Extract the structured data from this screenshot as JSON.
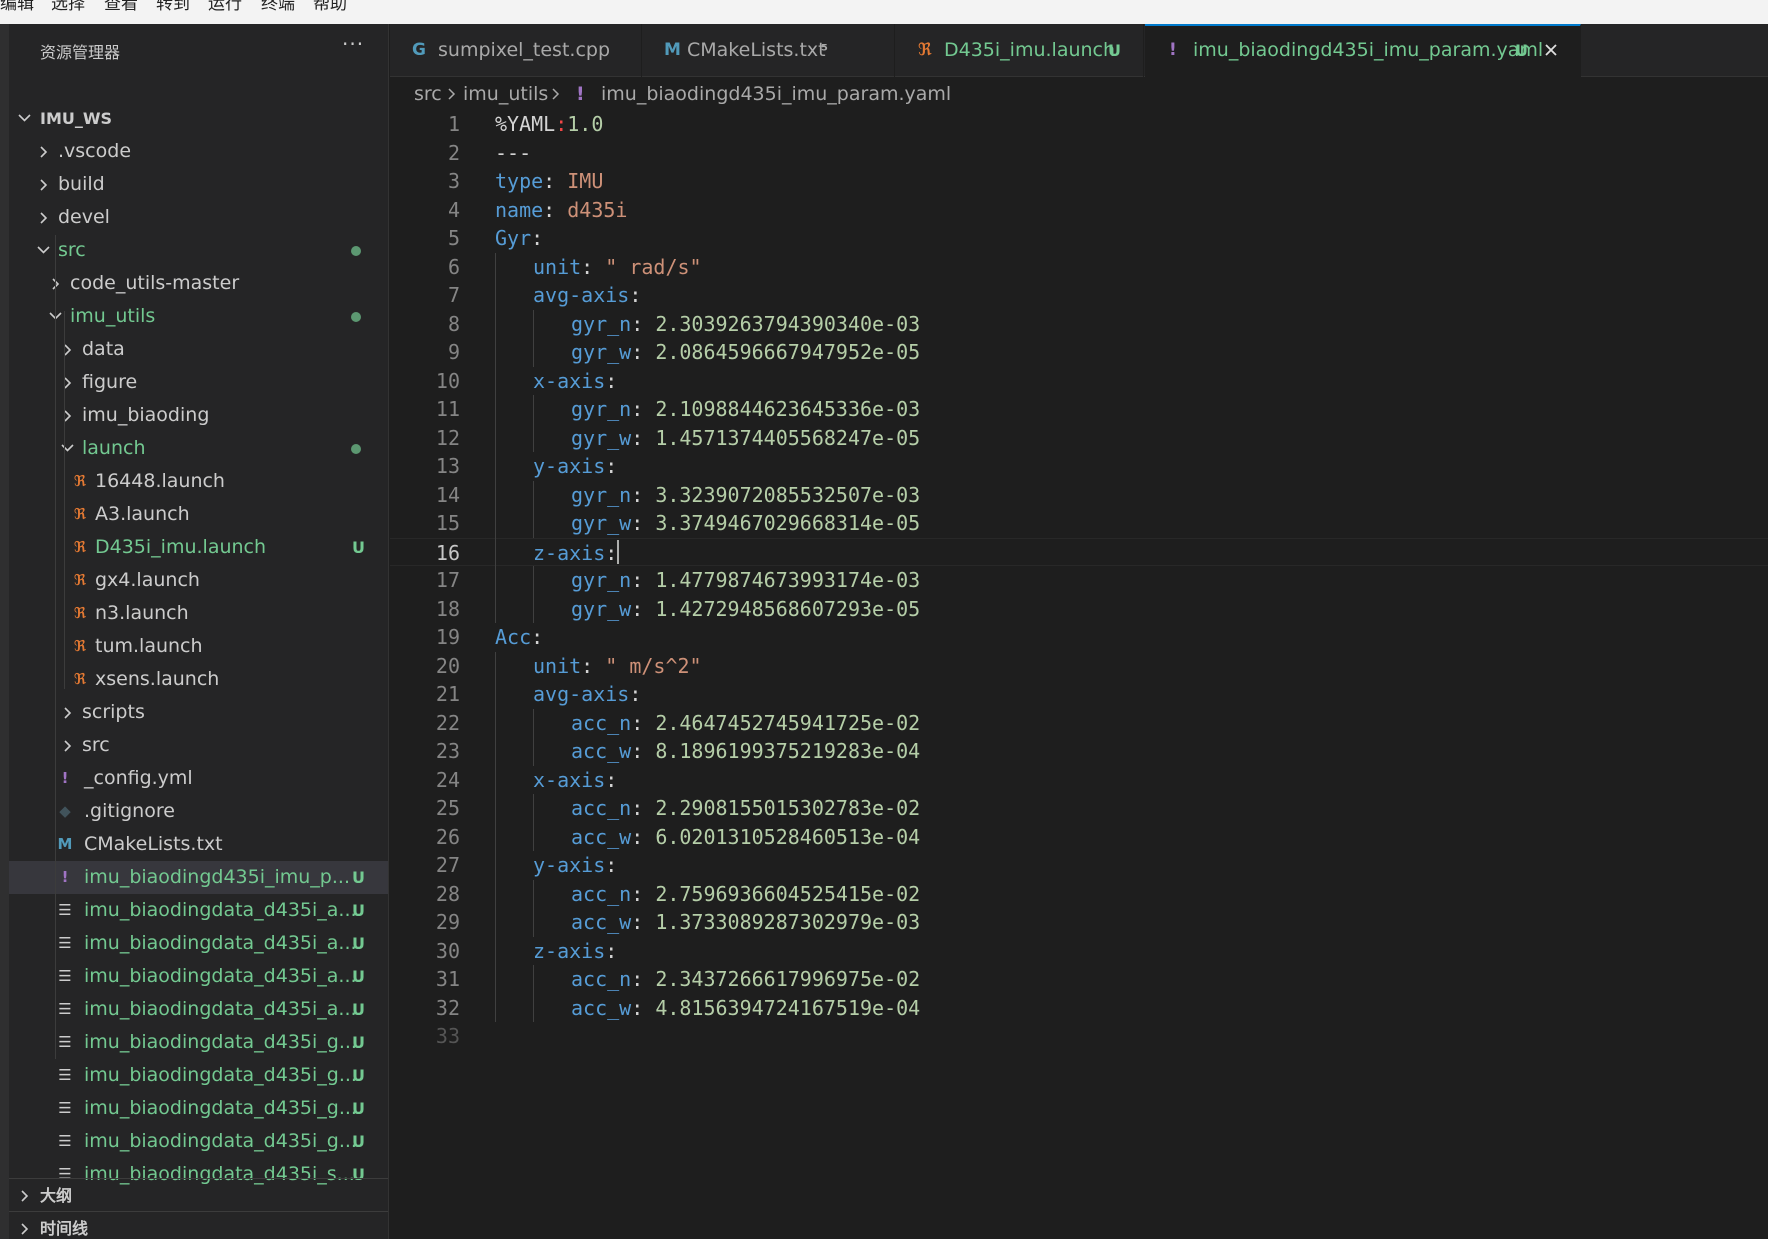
{
  "menu": [
    "编辑",
    "选择",
    "查看",
    "转到",
    "运行",
    "终端",
    "帮助"
  ],
  "sidebar": {
    "title": "资源管理器",
    "more": "···",
    "root": "IMU_WS",
    "items": [
      {
        "label": ".vscode",
        "status": ""
      },
      {
        "label": "build",
        "status": ""
      },
      {
        "label": "devel",
        "status": ""
      },
      {
        "label": "src",
        "status": "dot"
      },
      {
        "label": "code_utils-master",
        "status": ""
      },
      {
        "label": "imu_utils",
        "status": "dot"
      },
      {
        "label": "data",
        "status": ""
      },
      {
        "label": "figure",
        "status": ""
      },
      {
        "label": "imu_biaoding",
        "status": ""
      },
      {
        "label": "launch",
        "status": "dot"
      },
      {
        "label": "16448.launch",
        "status": ""
      },
      {
        "label": "A3.launch",
        "status": ""
      },
      {
        "label": "D435i_imu.launch",
        "status": "U"
      },
      {
        "label": "gx4.launch",
        "status": ""
      },
      {
        "label": "n3.launch",
        "status": ""
      },
      {
        "label": "tum.launch",
        "status": ""
      },
      {
        "label": "xsens.launch",
        "status": ""
      },
      {
        "label": "scripts",
        "status": ""
      },
      {
        "label": "src",
        "status": ""
      },
      {
        "label": "_config.yml",
        "status": ""
      },
      {
        "label": ".gitignore",
        "status": ""
      },
      {
        "label": "CMakeLists.txt",
        "status": ""
      },
      {
        "label": "imu_biaodingd435i_imu_p...",
        "status": "U"
      },
      {
        "label": "imu_biaodingdata_d435i_a...",
        "status": "U"
      },
      {
        "label": "imu_biaodingdata_d435i_a...",
        "status": "U"
      },
      {
        "label": "imu_biaodingdata_d435i_a...",
        "status": "U"
      },
      {
        "label": "imu_biaodingdata_d435i_a...",
        "status": "U"
      },
      {
        "label": "imu_biaodingdata_d435i_g...",
        "status": "U"
      },
      {
        "label": "imu_biaodingdata_d435i_g...",
        "status": "U"
      },
      {
        "label": "imu_biaodingdata_d435i_g...",
        "status": "U"
      },
      {
        "label": "imu_biaodingdata_d435i_g...",
        "status": "U"
      },
      {
        "label": "imu_biaodingdata_d435i_s...",
        "status": "U"
      }
    ],
    "outline": "大纲",
    "timeline": "时间线"
  },
  "tabs": [
    {
      "label": "sumpixel_test.cpp",
      "suffix": ""
    },
    {
      "label": "CMakeLists.txt",
      "suffix": "⁵"
    },
    {
      "label": "D435i_imu.launch",
      "suffix": "U"
    },
    {
      "label": "imu_biaodingd435i_imu_param.yaml",
      "suffix": "U"
    }
  ],
  "breadcrumb": [
    "src",
    "imu_utils",
    "imu_biaodingd435i_imu_param.yaml"
  ],
  "editor": {
    "lines": [
      {
        "n": "1",
        "key": "%YAML",
        "sep": ":",
        "val": "1.0"
      },
      {
        "n": "2",
        "key": "",
        "sep": "",
        "val": "---"
      },
      {
        "n": "3",
        "key": "type",
        "sep": ": ",
        "val": "IMU"
      },
      {
        "n": "4",
        "key": "name",
        "sep": ": ",
        "val": "d435i"
      },
      {
        "n": "5",
        "key": "Gyr",
        "sep": ":",
        "val": ""
      },
      {
        "n": "6",
        "key": "unit",
        "sep": ": ",
        "val": "\" rad/s\""
      },
      {
        "n": "7",
        "key": "avg-axis",
        "sep": ":",
        "val": ""
      },
      {
        "n": "8",
        "key": "gyr_n",
        "sep": ": ",
        "val": "2.3039263794390340e-03"
      },
      {
        "n": "9",
        "key": "gyr_w",
        "sep": ": ",
        "val": "2.0864596667947952e-05"
      },
      {
        "n": "10",
        "key": "x-axis",
        "sep": ":",
        "val": ""
      },
      {
        "n": "11",
        "key": "gyr_n",
        "sep": ": ",
        "val": "2.1098844623645336e-03"
      },
      {
        "n": "12",
        "key": "gyr_w",
        "sep": ": ",
        "val": "1.4571374405568247e-05"
      },
      {
        "n": "13",
        "key": "y-axis",
        "sep": ":",
        "val": ""
      },
      {
        "n": "14",
        "key": "gyr_n",
        "sep": ": ",
        "val": "3.3239072085532507e-03"
      },
      {
        "n": "15",
        "key": "gyr_w",
        "sep": ": ",
        "val": "3.3749467029668314e-05"
      },
      {
        "n": "16",
        "key": "z-axis",
        "sep": ":",
        "val": ""
      },
      {
        "n": "17",
        "key": "gyr_n",
        "sep": ": ",
        "val": "1.4779874673993174e-03"
      },
      {
        "n": "18",
        "key": "gyr_w",
        "sep": ": ",
        "val": "1.4272948568607293e-05"
      },
      {
        "n": "19",
        "key": "Acc",
        "sep": ":",
        "val": ""
      },
      {
        "n": "20",
        "key": "unit",
        "sep": ": ",
        "val": "\" m/s^2\""
      },
      {
        "n": "21",
        "key": "avg-axis",
        "sep": ":",
        "val": ""
      },
      {
        "n": "22",
        "key": "acc_n",
        "sep": ": ",
        "val": "2.4647452745941725e-02"
      },
      {
        "n": "23",
        "key": "acc_w",
        "sep": ": ",
        "val": "8.1896199375219283e-04"
      },
      {
        "n": "24",
        "key": "x-axis",
        "sep": ":",
        "val": ""
      },
      {
        "n": "25",
        "key": "acc_n",
        "sep": ": ",
        "val": "2.2908155015302783e-02"
      },
      {
        "n": "26",
        "key": "acc_w",
        "sep": ": ",
        "val": "6.0201310528460513e-04"
      },
      {
        "n": "27",
        "key": "y-axis",
        "sep": ":",
        "val": ""
      },
      {
        "n": "28",
        "key": "acc_n",
        "sep": ": ",
        "val": "2.7596936604525415e-02"
      },
      {
        "n": "29",
        "key": "acc_w",
        "sep": ": ",
        "val": "1.3733089287302979e-03"
      },
      {
        "n": "30",
        "key": "z-axis",
        "sep": ":",
        "val": ""
      },
      {
        "n": "31",
        "key": "acc_n",
        "sep": ": ",
        "val": "2.3437266617996975e-02"
      },
      {
        "n": "32",
        "key": "acc_w",
        "sep": ": ",
        "val": "4.8156394724167519e-04"
      },
      {
        "n": "33",
        "key": "",
        "sep": "",
        "val": ""
      }
    ]
  }
}
